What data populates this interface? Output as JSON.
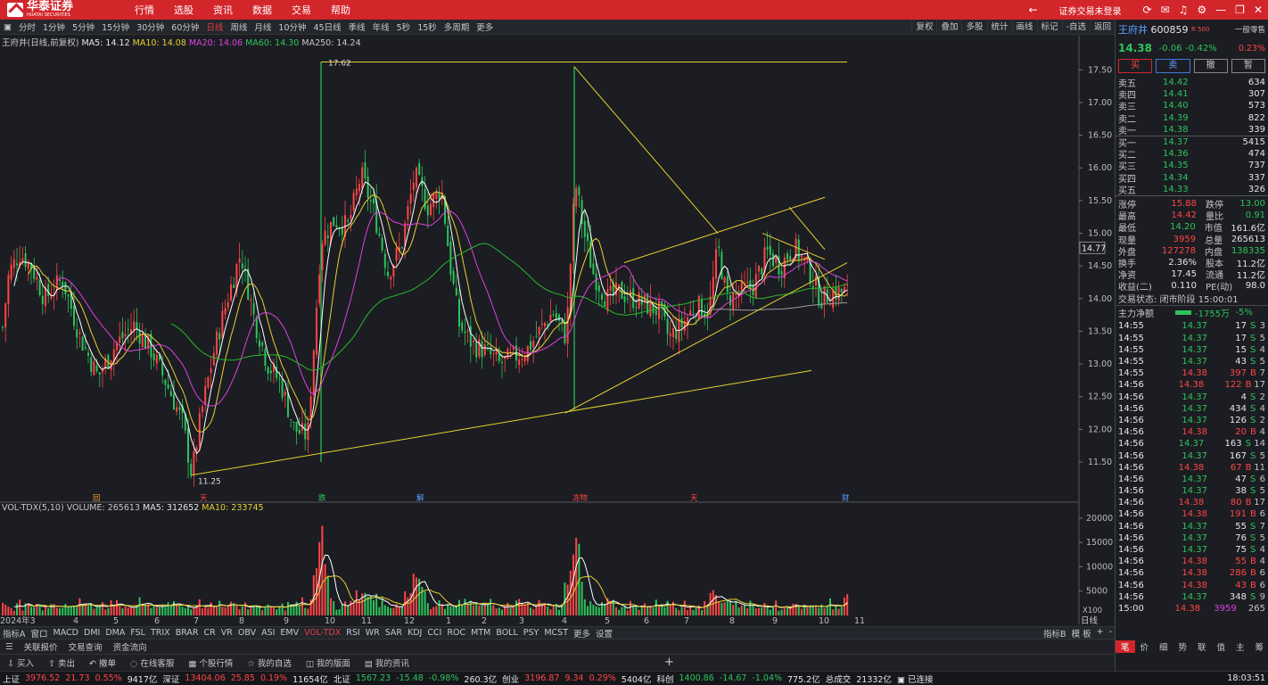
{
  "brand": {
    "name": "华泰证券",
    "sub": "HUATAI SECURITIES"
  },
  "menu": [
    "行情",
    "选股",
    "资讯",
    "数据",
    "交易",
    "帮助"
  ],
  "login": "证券交易未登录",
  "clock": "18:03:51",
  "periods": [
    "分时",
    "1分钟",
    "5分钟",
    "15分钟",
    "30分钟",
    "60分钟",
    "日线",
    "周线",
    "月线",
    "10分钟",
    "45日线",
    "季线",
    "年线",
    "5秒",
    "15秒",
    "多周期",
    "更多"
  ],
  "active_period": "日线",
  "tools": [
    "复权",
    "叠加",
    "多股",
    "统计",
    "画线",
    "标记",
    "-自选",
    "返回"
  ],
  "stock_title": "王府井(日线,前复权)",
  "ma": {
    "ma5": "MA5: 14.12",
    "ma10": "MA10: 14.08",
    "ma20": "MA20: 14.06",
    "ma60": "MA60: 14.30",
    "ma250": "MA250: 14.24"
  },
  "colors": {
    "up": "#ff4545",
    "down": "#2ec35c",
    "ma5": "#ffffff",
    "ma10": "#e8d030",
    "ma20": "#e040e0",
    "ma60": "#2ab82a",
    "ma250": "#9a9a9a",
    "trend": "#e8d030"
  },
  "chart_data": {
    "type": "candlestick",
    "symbol": "600859",
    "price_axis": [
      "17.50",
      "17.00",
      "16.50",
      "16.00",
      "15.50",
      "15.00",
      "14.50",
      "14.00",
      "13.50",
      "13.00",
      "12.50",
      "12.00",
      "11.50"
    ],
    "ylim": [
      11.2,
      17.75
    ],
    "months": [
      "2024年3",
      "4",
      "5",
      "6",
      "7",
      "8",
      "9",
      "10",
      "11",
      "12",
      "1",
      "2",
      "3",
      "4",
      "5",
      "6",
      "7",
      "8",
      "9",
      "10",
      "11"
    ],
    "high_label": "17.62",
    "low_label": "11.25",
    "last_price_tag": "14.77",
    "markers": [
      "回",
      "天",
      "跌",
      "解",
      "冻物",
      "天",
      "财"
    ],
    "close_path": [
      [
        0,
        13.2
      ],
      [
        10,
        14.4
      ],
      [
        22,
        14.7
      ],
      [
        35,
        14.5
      ],
      [
        50,
        14.0
      ],
      [
        70,
        14.3
      ],
      [
        90,
        13.4
      ],
      [
        110,
        12.8
      ],
      [
        130,
        13.3
      ],
      [
        150,
        13.6
      ],
      [
        170,
        13.2
      ],
      [
        190,
        12.6
      ],
      [
        205,
        12.1
      ],
      [
        215,
        11.3
      ],
      [
        225,
        12.2
      ],
      [
        240,
        13.2
      ],
      [
        255,
        14.0
      ],
      [
        270,
        14.7
      ],
      [
        285,
        13.7
      ],
      [
        300,
        13.0
      ],
      [
        315,
        12.7
      ],
      [
        330,
        12.0
      ],
      [
        345,
        11.9
      ],
      [
        360,
        14.9
      ],
      [
        375,
        15.2
      ],
      [
        390,
        15.1
      ],
      [
        405,
        15.9
      ],
      [
        420,
        15.3
      ],
      [
        435,
        14.4
      ],
      [
        450,
        14.8
      ],
      [
        465,
        15.9
      ],
      [
        480,
        15.4
      ],
      [
        495,
        15.7
      ],
      [
        505,
        14.5
      ],
      [
        515,
        13.6
      ],
      [
        530,
        13.3
      ],
      [
        545,
        13.2
      ],
      [
        560,
        13.0
      ],
      [
        575,
        13.1
      ],
      [
        590,
        13.2
      ],
      [
        605,
        13.5
      ],
      [
        620,
        13.8
      ],
      [
        635,
        13.4
      ],
      [
        645,
        15.8
      ],
      [
        655,
        15.0
      ],
      [
        665,
        14.4
      ],
      [
        680,
        14.0
      ],
      [
        695,
        14.1
      ],
      [
        710,
        14.0
      ],
      [
        725,
        13.9
      ],
      [
        740,
        13.8
      ],
      [
        750,
        13.4
      ],
      [
        765,
        13.6
      ],
      [
        780,
        13.9
      ],
      [
        795,
        13.8
      ],
      [
        805,
        14.8
      ],
      [
        815,
        14.0
      ],
      [
        830,
        14.1
      ],
      [
        845,
        14.2
      ],
      [
        860,
        14.7
      ],
      [
        875,
        14.5
      ],
      [
        890,
        14.8
      ],
      [
        905,
        14.5
      ],
      [
        920,
        14.0
      ],
      [
        935,
        14.1
      ],
      [
        950,
        14.1
      ]
    ],
    "volume_axis": [
      "20000",
      "15000",
      "10000",
      "5000"
    ],
    "volume_unit": "X100",
    "volume": {
      "label": "VOL-TDX(5,10)",
      "volume": "VOLUME: 265613",
      "ma5": "MA5: 312652",
      "ma10": "MA10: 233745"
    }
  },
  "indicators": [
    "指标A",
    "窗口",
    "MACD",
    "DMI",
    "DMA",
    "FSL",
    "TRIX",
    "BRAR",
    "CR",
    "VR",
    "OBV",
    "ASI",
    "EMV",
    "VOL-TDX",
    "RSI",
    "WR",
    "SAR",
    "KDJ",
    "CCI",
    "ROC",
    "MTM",
    "BOLL",
    "PSY",
    "MCST",
    "更多",
    "设置"
  ],
  "active_indicator": "VOL-TDX",
  "indicator_right": [
    "指标B",
    "模 板",
    "+",
    "-"
  ],
  "quote_tabs": [
    "关联报价",
    "交易查询",
    "资金流向"
  ],
  "axis_label": "日线",
  "actions": [
    "买入",
    "卖出",
    "撤单",
    "在线客服",
    "个股行情",
    "我的自选",
    "我的版面",
    "我的资讯"
  ],
  "status": [
    {
      "n": "上证",
      "v": "3976.52",
      "c": "21.73",
      "p": "0.55%",
      "a": "9417亿",
      "up": true
    },
    {
      "n": "深证",
      "v": "13404.06",
      "c": "25.85",
      "p": "0.19%",
      "a": "11654亿",
      "up": true
    },
    {
      "n": "北证",
      "v": "1567.23",
      "c": "-15.48",
      "p": "-0.98%",
      "a": "260.3亿",
      "up": false
    },
    {
      "n": "创业",
      "v": "3196.87",
      "c": "9.34",
      "p": "0.29%",
      "a": "5404亿",
      "up": true
    },
    {
      "n": "科创",
      "v": "1400.86",
      "c": "-14.67",
      "p": "-1.04%",
      "a": "775.2亿",
      "up": false
    }
  ],
  "status_total": {
    "label": "总成交",
    "value": "21332亿",
    "conn": "已连接"
  },
  "panel": {
    "name": "王府井",
    "code": "600859",
    "badge": "R 500",
    "mode": "一般零售",
    "price": "14.38",
    "change": "-0.06",
    "pct": "-0.42%",
    "pct2": "0.23%",
    "buttons": [
      "买",
      "卖",
      "撤",
      "暂"
    ],
    "asks": [
      [
        "卖五",
        "14.42",
        "634"
      ],
      [
        "卖四",
        "14.41",
        "307"
      ],
      [
        "卖三",
        "14.40",
        "573"
      ],
      [
        "卖二",
        "14.39",
        "822"
      ],
      [
        "卖一",
        "14.38",
        "339"
      ]
    ],
    "bids": [
      [
        "买一",
        "14.37",
        "5415"
      ],
      [
        "买二",
        "14.36",
        "474"
      ],
      [
        "买三",
        "14.35",
        "737"
      ],
      [
        "买四",
        "14.34",
        "337"
      ],
      [
        "买五",
        "14.33",
        "326"
      ]
    ],
    "stats": [
      [
        "涨停",
        "15.88",
        "跌停",
        "13.00"
      ],
      [
        "最高",
        "14.42",
        "量比",
        "0.91"
      ],
      [
        "最低",
        "14.20",
        "市值",
        "161.6亿"
      ],
      [
        "现量",
        "3959",
        "总量",
        "265613"
      ],
      [
        "外盘",
        "127278",
        "内盘",
        "138335"
      ],
      [
        "换手",
        "2.36%",
        "股本",
        "11.2亿"
      ],
      [
        "净资",
        "17.45",
        "流通",
        "11.2亿"
      ],
      [
        "收益(二)",
        "0.110",
        "PE(动)",
        "98.0"
      ]
    ],
    "trade_state": "交易状态: 闭市阶段 15:00:01",
    "flow": {
      "label": "主力净额",
      "value": "-1755万",
      "pct": "-5%"
    },
    "ticks": [
      [
        "14:55",
        "14.37",
        "17",
        "S",
        "3"
      ],
      [
        "14:55",
        "14.37",
        "17",
        "S",
        "5"
      ],
      [
        "14:55",
        "14.37",
        "15",
        "S",
        "4"
      ],
      [
        "14:55",
        "14.37",
        "43",
        "S",
        "5"
      ],
      [
        "14:55",
        "14.38",
        "397",
        "B",
        "7"
      ],
      [
        "14:56",
        "14.38",
        "122",
        "B",
        "17"
      ],
      [
        "14:56",
        "14.37",
        "4",
        "S",
        "2"
      ],
      [
        "14:56",
        "14.37",
        "434",
        "S",
        "4"
      ],
      [
        "14:56",
        "14.37",
        "126",
        "S",
        "2"
      ],
      [
        "14:56",
        "14.38",
        "20",
        "B",
        "4"
      ],
      [
        "14:56",
        "14.37",
        "163",
        "S",
        "14"
      ],
      [
        "14:56",
        "14.37",
        "167",
        "S",
        "5"
      ],
      [
        "14:56",
        "14.38",
        "67",
        "B",
        "11"
      ],
      [
        "14:56",
        "14.37",
        "47",
        "S",
        "6"
      ],
      [
        "14:56",
        "14.37",
        "38",
        "S",
        "5"
      ],
      [
        "14:56",
        "14.38",
        "80",
        "B",
        "17"
      ],
      [
        "14:56",
        "14.38",
        "191",
        "B",
        "6"
      ],
      [
        "14:56",
        "14.37",
        "55",
        "S",
        "7"
      ],
      [
        "14:56",
        "14.37",
        "76",
        "S",
        "5"
      ],
      [
        "14:56",
        "14.37",
        "75",
        "S",
        "4"
      ],
      [
        "14:56",
        "14.38",
        "55",
        "B",
        "4"
      ],
      [
        "14:56",
        "14.38",
        "286",
        "B",
        "6"
      ],
      [
        "14:56",
        "14.38",
        "43",
        "B",
        "6"
      ],
      [
        "14:56",
        "14.37",
        "348",
        "S",
        "9"
      ],
      [
        "15:00",
        "14.38",
        "3959",
        "",
        "265"
      ]
    ],
    "tabs": [
      "笔",
      "价",
      "细",
      "势",
      "联",
      "值",
      "主",
      "筹"
    ]
  }
}
